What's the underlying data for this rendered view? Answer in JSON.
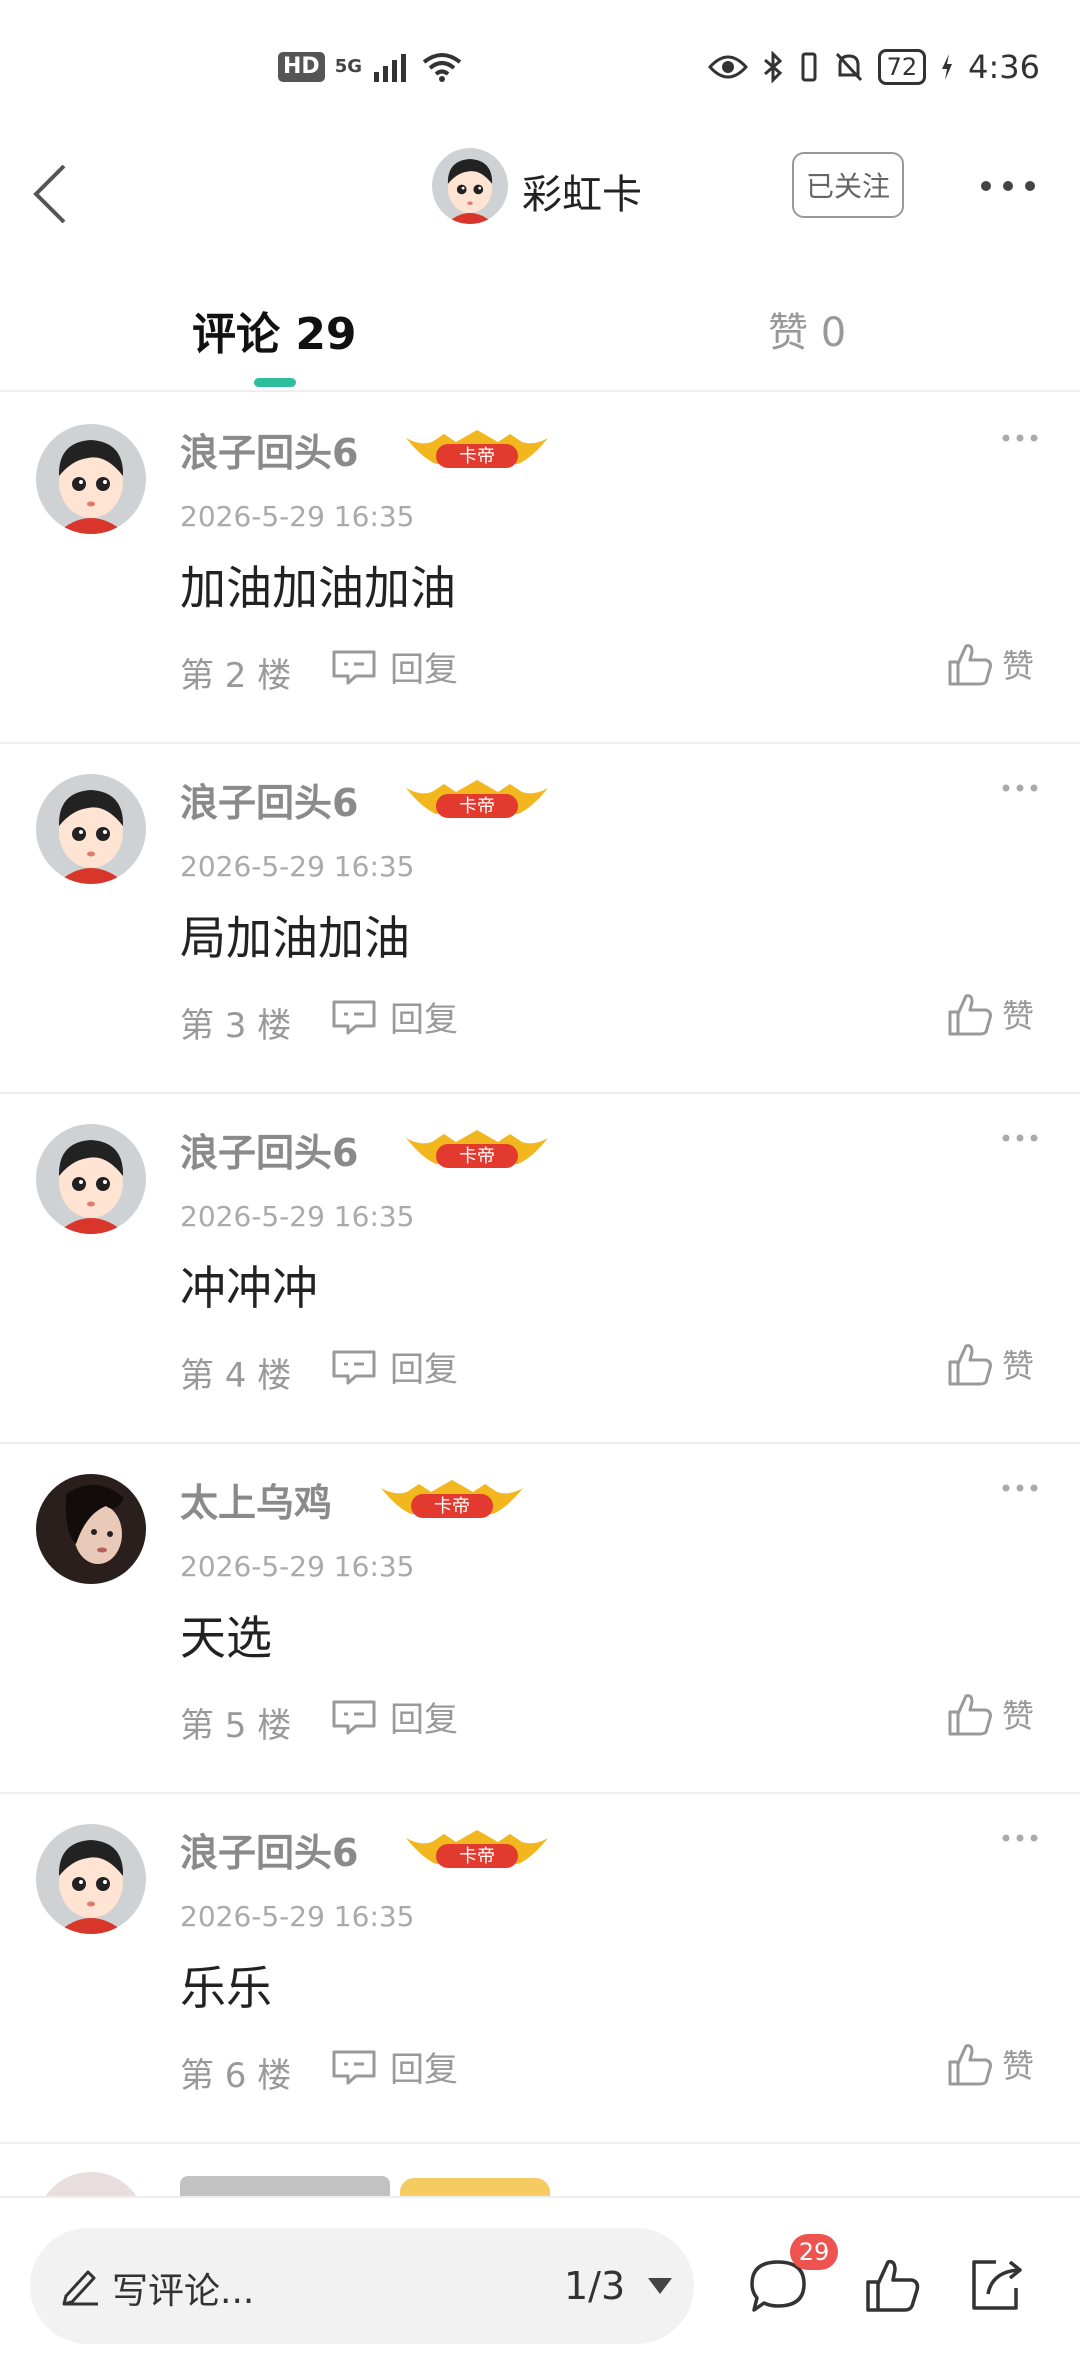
{
  "status_bar": {
    "hd": "HD",
    "network": "5G",
    "battery": "72",
    "time": "4:36"
  },
  "header": {
    "title": "彩虹卡",
    "follow_label": "已关注"
  },
  "tabs": {
    "comments_label": "评论 29",
    "likes_label": "赞 0"
  },
  "comments": [
    {
      "name": "浪子回头6",
      "badge": "卡帝",
      "time": "2026-5-29 16:35",
      "text": "加油加油加油",
      "floor": "第 2 楼",
      "reply": "回复",
      "like": "赞"
    },
    {
      "name": "浪子回头6",
      "badge": "卡帝",
      "time": "2026-5-29 16:35",
      "text": "局加油加油",
      "floor": "第 3 楼",
      "reply": "回复",
      "like": "赞"
    },
    {
      "name": "浪子回头6",
      "badge": "卡帝",
      "time": "2026-5-29 16:35",
      "text": "冲冲冲",
      "floor": "第 4 楼",
      "reply": "回复",
      "like": "赞"
    },
    {
      "name": "太上乌鸡",
      "badge": "卡帝",
      "time": "2026-5-29 16:35",
      "text": "天选",
      "floor": "第 5 楼",
      "reply": "回复",
      "like": "赞"
    },
    {
      "name": "浪子回头6",
      "badge": "卡帝",
      "time": "2026-5-29 16:35",
      "text": "乐乐",
      "floor": "第 6 楼",
      "reply": "回复",
      "like": "赞"
    }
  ],
  "bottom_bar": {
    "placeholder": "写评论...",
    "page_indicator": "1/3",
    "comment_count": "29"
  },
  "colors": {
    "accent": "#2dbf9b",
    "badge_red": "#ef5350"
  }
}
